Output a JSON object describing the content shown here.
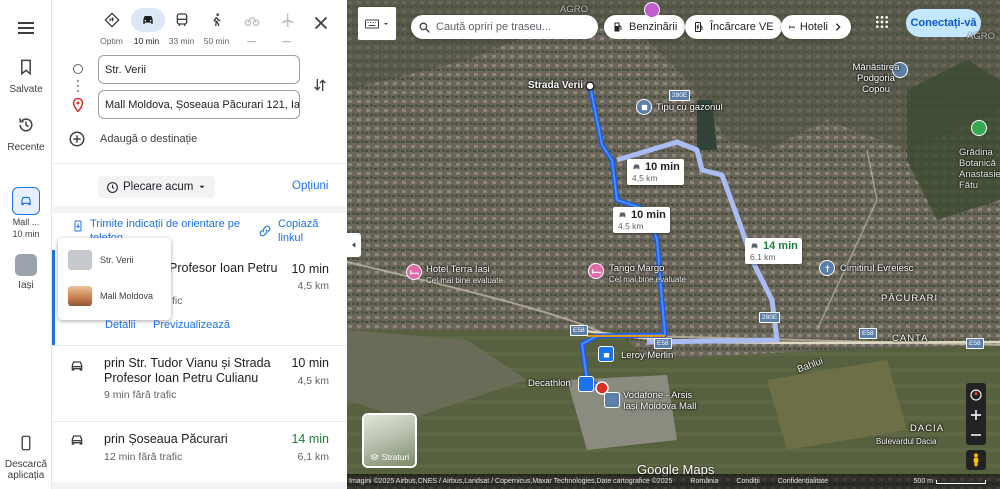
{
  "rail": {
    "saved_label": "Salvate",
    "recent_label": "Recente",
    "mode_label_1": "Mall ...",
    "mode_time": "10 min",
    "city_label": "Iași",
    "download_label": "Descarcă aplicația"
  },
  "modes": [
    {
      "name": "best",
      "time": "Optim"
    },
    {
      "name": "car",
      "time": "10 min"
    },
    {
      "name": "transit",
      "time": "33 min"
    },
    {
      "name": "walk",
      "time": "50 min"
    },
    {
      "name": "bike",
      "time": "—"
    },
    {
      "name": "flight",
      "time": "—"
    }
  ],
  "directions": {
    "origin": "Str. Verii",
    "destination": "Mall Moldova, Șoseaua Păcurari 121, Iași",
    "add_destination": "Adaugă o destinație",
    "depart": "Plecare acum",
    "options": "Opțiuni",
    "send_phone": "Trimite indicații de orientare pe telefon",
    "copy_link": "Copiază linkul"
  },
  "popup": {
    "item1": "Str. Verii",
    "item2": "Mall Moldova"
  },
  "routes": [
    {
      "title": "prin Str. Tudor Vianu și Strada Profesor Ioan Petru Culianu",
      "title_visible": "Profesor Ioan Petru",
      "sub": "9 min fără trafic",
      "sub_visible": "fic",
      "time": "10 min",
      "dist": "4,5 km",
      "details": "Detalii",
      "preview": "Previzualizează"
    },
    {
      "title": "prin Str. Tudor Vianu și Strada Profesor Ioan Petru Culianu",
      "sub": "9 min fără trafic",
      "time": "10 min",
      "dist": "4,5 km"
    },
    {
      "title": "prin Șoseaua Păcurari",
      "sub": "12 min fără trafic",
      "time": "14 min",
      "dist": "6,1 km"
    }
  ],
  "map": {
    "search_placeholder": "Caută opriri pe traseu...",
    "chips": [
      "Benzinării",
      "Încărcare VE",
      "Hoteli"
    ],
    "signin": "Conectați-vă",
    "layers": "Straturi",
    "callouts": [
      {
        "time": "10 min",
        "dist": "4,5 km"
      },
      {
        "time": "10 min",
        "dist": "4,5 km"
      },
      {
        "time": "14 min",
        "dist": "6,1 km"
      }
    ],
    "places": {
      "strada_verii": "Strada Verii",
      "tipu": "Tipu cu gazonul",
      "hotel_terra": "Hotel Terra Iași",
      "hotel_sub": "Cel mai bine evaluate",
      "tango": "Tango Margo",
      "tango_sub": "Cel mai bine evaluate",
      "leroy": "Leroy Merlin",
      "decathlon": "Decathlon",
      "vodafone": "Vodafone - Arsis",
      "mall": "Iași Moldova Mall",
      "cimitir": "Cimitirul Evreiesc",
      "manastire": "Mănăstirea Podgoria Copou",
      "gradina": "Grădina Botanică Anastasie Fătu",
      "pacurari": "PĂCURARI",
      "canta": "CANTA",
      "dacia": "DACIA",
      "bahlui": "Bahlui",
      "agro": "AGRO",
      "poder": "Bulevardul Dacia"
    },
    "shields": [
      "280E",
      "280E",
      "E583",
      "E58",
      "E58",
      "E58",
      "E58",
      "280E",
      "E58"
    ],
    "attribution": "Imagini ©2025 Airbus,CNES / Airbus,Landsat / Copernicus,Maxar Technologies,Date cartografice ©2025",
    "romania": "România",
    "terms": "Condiții",
    "privacy": "Confidențialitate",
    "feedback": "Trimiteți feedback despre produs",
    "scale": "500 m",
    "google": "Google Maps"
  }
}
